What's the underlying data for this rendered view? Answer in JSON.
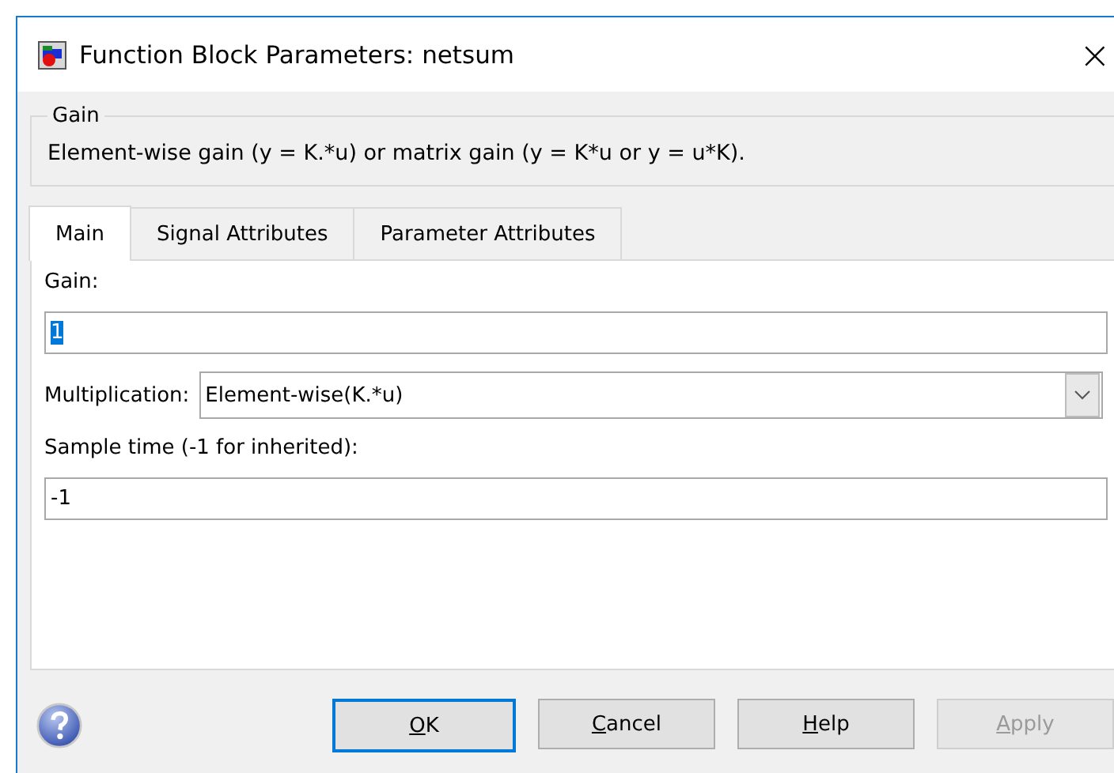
{
  "window": {
    "title": "Function Block Parameters: netsum",
    "close": "×"
  },
  "group": {
    "title": "Gain",
    "description": "Element-wise gain (y = K.*u) or matrix gain (y = K*u or y = u*K)."
  },
  "tabs": [
    {
      "label": "Main",
      "selected": true
    },
    {
      "label": "Signal Attributes",
      "selected": false
    },
    {
      "label": "Parameter Attributes",
      "selected": false
    }
  ],
  "gain": {
    "label": "Gain:",
    "value": "1",
    "text_selected": true
  },
  "multiplication": {
    "label": "Multiplication:",
    "value": "Element-wise(K.*u)"
  },
  "sample_time": {
    "label": "Sample time (-1 for inherited):",
    "value": "-1"
  },
  "buttons": [
    {
      "label": "OK",
      "underline_first": true,
      "focused": true,
      "disabled": false
    },
    {
      "label": "Cancel",
      "underline_first": true,
      "focused": false,
      "disabled": false
    },
    {
      "label": "Help",
      "underline_first": true,
      "focused": false,
      "disabled": false
    },
    {
      "label": "Apply",
      "underline_first": true,
      "focused": false,
      "disabled": true
    }
  ]
}
